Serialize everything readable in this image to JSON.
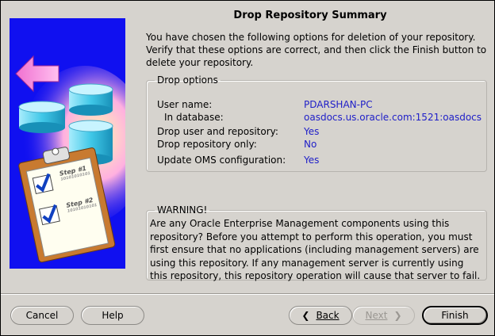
{
  "dialog": {
    "title": "Drop Repository Summary",
    "intro": "You have chosen the following options for deletion of your repository. Verify that these options are correct, and then click the Finish button to delete your repository."
  },
  "drop_options": {
    "legend": "Drop options",
    "rows": [
      {
        "label": "User name:",
        "value": "PDARSHAN-PC"
      },
      {
        "label": "In database:",
        "value": "oasdocs.us.oracle.com:1521:oasdocs"
      },
      {
        "label": "Drop user and repository:",
        "value": "Yes"
      },
      {
        "label": "Drop repository only:",
        "value": "No"
      },
      {
        "label": "Update OMS configuration:",
        "value": "Yes"
      }
    ]
  },
  "warning": {
    "legend": "WARNING!",
    "text": "Are any Oracle Enterprise Management components using this repository? Before you attempt to perform this operation, you must first ensure that no applications (including management servers) are using this repository. If any management server is currently using this repository, this repository operation will cause that server to fail."
  },
  "image": {
    "step1": "Step #1",
    "step2": "Step #2",
    "binary": "10101010101"
  },
  "buttons": {
    "cancel": "Cancel",
    "help": "Help",
    "back": "Back",
    "next": "Next",
    "finish": "Finish"
  },
  "colors": {
    "value_text": "#1e1ec8",
    "image_bg": "#1010f0",
    "arrow": "#e060c0",
    "cylinder": "#3cc8e8"
  }
}
